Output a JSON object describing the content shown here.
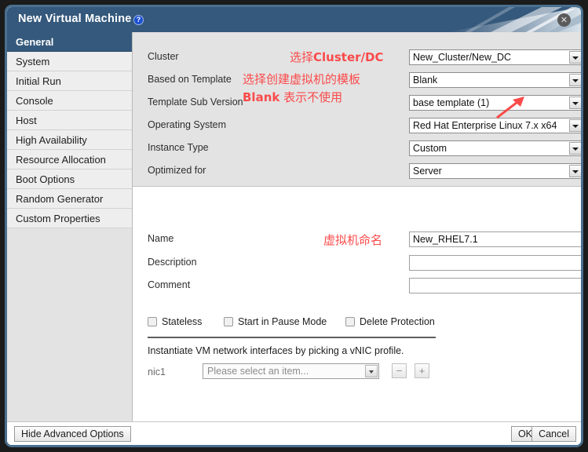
{
  "window": {
    "title": "New Virtual Machine",
    "help_icon": "question-circle-icon",
    "close_icon": "✕"
  },
  "sidebar": {
    "items": [
      {
        "label": "General",
        "active": true
      },
      {
        "label": "System",
        "active": false
      },
      {
        "label": "Initial Run",
        "active": false
      },
      {
        "label": "Console",
        "active": false
      },
      {
        "label": "Host",
        "active": false
      },
      {
        "label": "High Availability",
        "active": false
      },
      {
        "label": "Resource Allocation",
        "active": false
      },
      {
        "label": "Boot Options",
        "active": false
      },
      {
        "label": "Random Generator",
        "active": false
      },
      {
        "label": "Custom Properties",
        "active": false
      }
    ]
  },
  "form": {
    "dropdowns": [
      {
        "label": "Cluster",
        "value": "New_Cluster/New_DC"
      },
      {
        "label": "Based on Template",
        "value": "Blank"
      },
      {
        "label": "Template Sub Version",
        "value": "base template (1)"
      },
      {
        "label": "Operating System",
        "value": "Red Hat Enterprise Linux 7.x x64"
      },
      {
        "label": "Instance Type",
        "value": "Custom"
      },
      {
        "label": "Optimized for",
        "value": "Server"
      }
    ],
    "text_fields": [
      {
        "label": "Name",
        "value": "New_RHEL7.1",
        "placeholder": ""
      },
      {
        "label": "Description",
        "value": "",
        "placeholder": ""
      },
      {
        "label": "Comment",
        "value": "",
        "placeholder": ""
      }
    ],
    "checkboxes": [
      {
        "label": "Stateless",
        "checked": false
      },
      {
        "label": "Start in Pause Mode",
        "checked": false
      },
      {
        "label": "Delete Protection",
        "checked": false
      }
    ],
    "nic_section": {
      "description": "Instantiate VM network interfaces by picking a vNIC profile.",
      "nic_label": "nic1",
      "nic_value": "Please select an item...",
      "remove_label": "−",
      "add_label": "+"
    }
  },
  "footer": {
    "hide_advanced": "Hide Advanced Options",
    "ok": "OK",
    "cancel": "Cancel"
  },
  "annotations": [
    {
      "id": "a1",
      "prefix": "选择",
      "bold": "Cluster/DC",
      "suffix": ""
    },
    {
      "id": "a2",
      "prefix": "选择创建虚拟机的模板",
      "bold": "",
      "suffix": ""
    },
    {
      "id": "a3",
      "prefix": "",
      "bold": "Blank",
      "suffix": " 表示不使用"
    },
    {
      "id": "a4",
      "prefix": "虚拟机命名",
      "bold": "",
      "suffix": ""
    }
  ],
  "colors": {
    "titlebar": "#35597c",
    "accent": "#35597c",
    "annotation_red": "#fb4a4a",
    "panel_gray": "#e3e3e3",
    "sidebar_item": "#eeeeee"
  }
}
